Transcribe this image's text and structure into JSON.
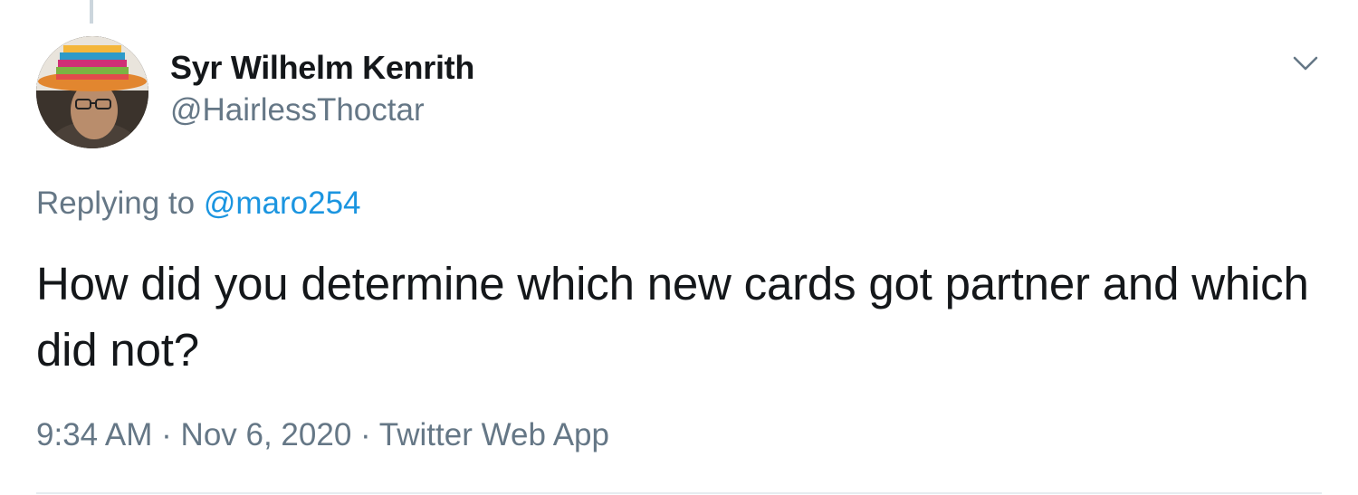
{
  "tweet": {
    "author": {
      "display_name": "Syr Wilhelm Kenrith",
      "handle": "@HairlessThoctar"
    },
    "replying_to": {
      "prefix": "Replying to",
      "mention": "@maro254"
    },
    "text": "How did you determine which new cards got partner and which did not?",
    "meta": {
      "time": "9:34 AM",
      "separator": "·",
      "date": "Nov 6, 2020",
      "source": "Twitter Web App"
    }
  },
  "icons": {
    "more": "chevron-down-icon"
  },
  "colors": {
    "text_primary": "#14171a",
    "text_secondary": "#657786",
    "link": "#1b95e0",
    "divider": "#e6ecf0"
  }
}
